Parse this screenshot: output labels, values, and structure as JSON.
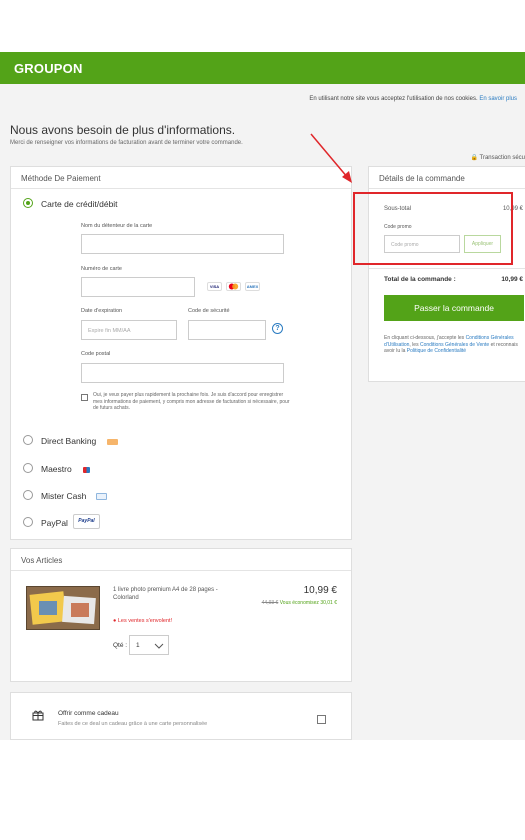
{
  "header": {
    "logo": "GROUPON"
  },
  "cookie_bar": {
    "text": "En utilisant notre site vous acceptez l'utilisation de nos cookies.",
    "link": "En savoir plus"
  },
  "page": {
    "title": "Nous avons besoin de plus d'informations.",
    "subtitle": "Merci de renseigner vos informations de facturation avant de terminer votre commande.",
    "secure": "Transaction sécu"
  },
  "payment": {
    "heading": "Méthode De Paiement",
    "credit_card": {
      "label": "Carte de crédit/débit",
      "holder_label": "Nom du détenteur de la carte",
      "number_label": "Numéro de carte",
      "cards": [
        "VISA",
        "MC",
        "AMEX"
      ],
      "expiry_label": "Date d'expiration",
      "expiry_placeholder": "Expire fin MM/AA",
      "cvc_label": "Code de sécurité",
      "postal_label": "Code postal",
      "save_text": "Oui, je veux payer plus rapidement la prochaine fois. Je suis d'accord pour enregistrer mes informations de paiement, y compris mon adresse de facturation si nécessaire, pour de futurs achats."
    },
    "methods": [
      {
        "label": "Direct Banking"
      },
      {
        "label": "Maestro"
      },
      {
        "label": "Mister Cash"
      },
      {
        "label": "PayPal",
        "badge": "PayPal"
      }
    ]
  },
  "articles": {
    "heading": "Vos Articles",
    "item": {
      "name": "1 livre photo premium A4 de 28 pages - Colorland",
      "price": "10,99 €",
      "old_price": "44,93 €",
      "savings": "Vous économisez 30,01 €",
      "urgency": "Les ventes s'envolent!",
      "qty_label": "Qté :",
      "qty_value": "1"
    }
  },
  "gift": {
    "title": "Offrir comme cadeau",
    "description": "Faites de ce deal un cadeau grâce à une carte personnalisée"
  },
  "summary": {
    "heading": "Détails de la commande",
    "subtotal_label": "Sous-total",
    "subtotal_value": "10,99 €",
    "promo_label": "Code promo",
    "promo_placeholder": "Code promo",
    "apply_label": "Appliquer",
    "total_label": "Total de la commande :",
    "total_value": "10,99 €",
    "checkout_label": "Passer la commande",
    "legal_prefix": "En cliquant ci-dessous, j'accepte les",
    "legal_link1": "Conditions Générales d'Utilisation",
    "legal_mid1": ", les",
    "legal_link2": "Conditions Générales de Vente",
    "legal_mid2": "et reconnais avoir lu la",
    "legal_link3": "Politique de Confidentialité"
  },
  "colors": {
    "brand": "#53a318",
    "link": "#2a7bc1",
    "annotation": "#e0262a"
  }
}
